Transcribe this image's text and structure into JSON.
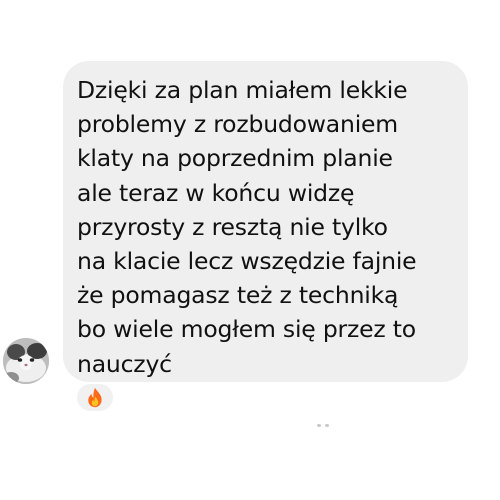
{
  "message": {
    "lines": [
      "Dzięki za plan miałem lekkie",
      "problemy z rozbudowaniem",
      "klaty na poprzednim planie",
      "ale teraz w końcu widzę",
      "przyrosty z resztą nie tylko",
      "na klacie lecz wszędzie fajnie",
      "że pomagasz też z techniką",
      "bo wiele mogłem się przez to",
      "nauczyć"
    ]
  },
  "reaction": {
    "icon": "fire-icon"
  },
  "colors": {
    "bubble_background": "#efefef",
    "text": "#111111",
    "fire_outer": "#ff6a1a",
    "fire_inner": "#ffc21f"
  }
}
